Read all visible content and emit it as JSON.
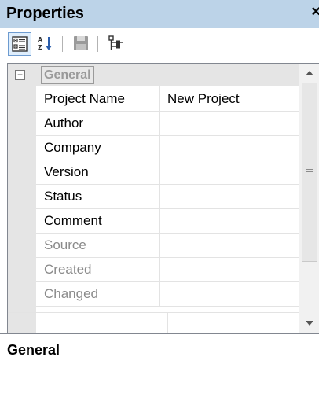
{
  "panel": {
    "title": "Properties",
    "close_symbol": "×"
  },
  "toolbar": {
    "buttons": [
      {
        "name": "categorized-view",
        "icon": "categorized-icon",
        "active": true
      },
      {
        "name": "alphabetical-sort",
        "icon": "sort-az-icon",
        "active": false
      },
      {
        "name": "save",
        "icon": "floppy-disk-icon",
        "active": false
      },
      {
        "name": "structure",
        "icon": "tree-structure-icon",
        "active": false
      }
    ]
  },
  "grid": {
    "category": {
      "label": "General",
      "expander": "−",
      "expanded": true
    },
    "properties": [
      {
        "name": "Project Name",
        "value": "New Project",
        "enabled": true
      },
      {
        "name": "Author",
        "value": "",
        "enabled": true
      },
      {
        "name": "Company",
        "value": "",
        "enabled": true
      },
      {
        "name": "Version",
        "value": "",
        "enabled": true
      },
      {
        "name": "Status",
        "value": "",
        "enabled": true
      },
      {
        "name": "Comment",
        "value": "",
        "enabled": true
      },
      {
        "name": "Source",
        "value": "",
        "enabled": false
      },
      {
        "name": "Created",
        "value": "",
        "enabled": false
      },
      {
        "name": "Changed",
        "value": "",
        "enabled": false
      }
    ]
  },
  "description": {
    "title": "General"
  },
  "colors": {
    "titlebar": "#bcd3e8",
    "gutter": "#e5e5e5",
    "disabled_text": "#8a8a8a",
    "active_button_border": "#6d9bd0"
  }
}
